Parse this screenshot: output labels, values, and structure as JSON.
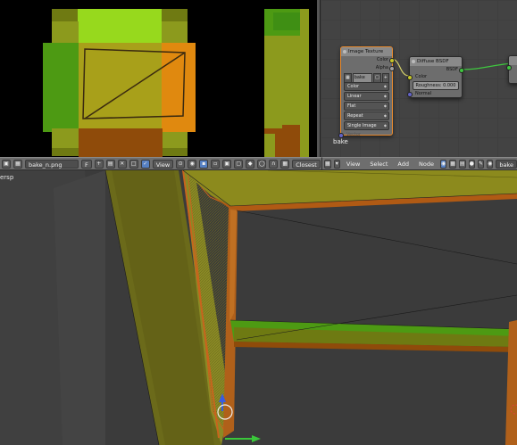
{
  "image_editor": {
    "header": {
      "image_name": "bake_n.png",
      "fake_user_label": "F",
      "view_menu": "View",
      "interpolation": "Closest"
    }
  },
  "node_editor": {
    "header": {
      "menus": [
        "View",
        "Select",
        "Add",
        "Node"
      ],
      "material_name": "bake"
    },
    "material_label": "bake",
    "image_texture_node": {
      "title": "Image Texture",
      "outputs": [
        "Color",
        "Alpha"
      ],
      "image_field": "bake",
      "color_space": "Color",
      "interpolation": "Linear",
      "projection": "Flat",
      "extension": "Repeat",
      "source": "Single Image",
      "input": "Vector"
    },
    "diffuse_node": {
      "title": "Diffuse BSDF",
      "output": "BSDF",
      "inputs": [
        "Color",
        "Normal"
      ],
      "roughness_label": "Roughness:",
      "roughness_value": "0.000"
    }
  },
  "viewport": {
    "view_label": "ersp"
  },
  "colors": {
    "uv_green_light": "#97d91d",
    "uv_green_dark": "#4d9a13",
    "uv_olive": "#8c9a1d",
    "uv_orange": "#e0890f",
    "uv_brown": "#8f4b0a",
    "node_selected": "#e88a2e",
    "socket_yellow": "#c7c729",
    "socket_green": "#3fc73f",
    "socket_blue": "#6363c7",
    "socket_grey": "#a1a1a1"
  }
}
